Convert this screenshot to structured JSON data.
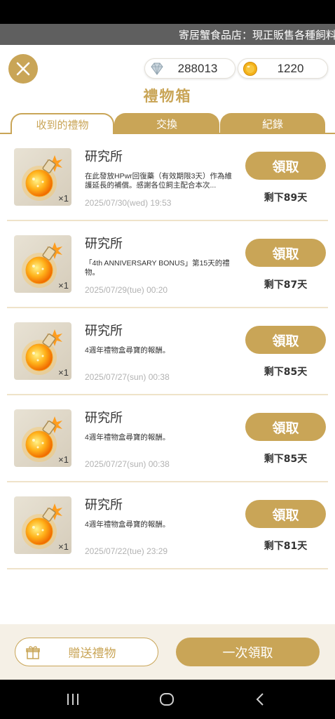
{
  "ticker": {
    "text": "寄居蟹食品店：現正販售各種飼料"
  },
  "currency": {
    "gems": "288013",
    "coins": "1220"
  },
  "title": "禮物箱",
  "tabs": [
    {
      "label": "收到的禮物",
      "active": true
    },
    {
      "label": "交換",
      "active": false
    },
    {
      "label": "紀錄",
      "active": false
    }
  ],
  "gifts": [
    {
      "sender": "研究所",
      "qty": "×1",
      "desc": "在此發放HPwr回復藥（有效期限3天）作為維護延長的補償。感謝各位飼主配合本次...",
      "date": "2025/07/30(wed) 19:53",
      "claim_label": "領取",
      "remaining": "剩下89天"
    },
    {
      "sender": "研究所",
      "qty": "×1",
      "desc": "「4th ANNIVERSARY BONUS」第15天的禮物。",
      "date": "2025/07/29(tue) 00:20",
      "claim_label": "領取",
      "remaining": "剩下87天"
    },
    {
      "sender": "研究所",
      "qty": "×1",
      "desc": "4週年禮物盒尋寶的報酬。",
      "date": "2025/07/27(sun) 00:38",
      "claim_label": "領取",
      "remaining": "剩下85天"
    },
    {
      "sender": "研究所",
      "qty": "×1",
      "desc": "4週年禮物盒尋寶的報酬。",
      "date": "2025/07/27(sun) 00:38",
      "claim_label": "領取",
      "remaining": "剩下85天"
    },
    {
      "sender": "研究所",
      "qty": "×1",
      "desc": "4週年禮物盒尋寶的報酬。",
      "date": "2025/07/22(tue) 23:29",
      "claim_label": "領取",
      "remaining": "剩下81天"
    }
  ],
  "bottom": {
    "send_gift_label": "贈送禮物",
    "claim_all_label": "一次領取"
  },
  "icons": {
    "item": "potion-flask-icon",
    "gem": "diamond-icon",
    "coin": "coin-icon",
    "gift": "gift-box-icon",
    "close": "close-icon"
  },
  "colors": {
    "accent": "#c9a557",
    "divider": "#efe3c9",
    "date": "#b2b2b2"
  }
}
